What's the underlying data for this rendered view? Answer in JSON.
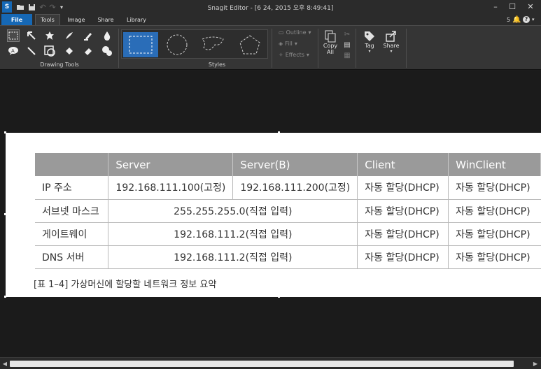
{
  "titlebar": {
    "title": "Snagit Editor - [6 24, 2015 오후 8:49:41]",
    "app_icon": "S",
    "minimize": "–",
    "maximize": "☐",
    "close": "✕"
  },
  "tabs": [
    "File",
    "Tools",
    "Image",
    "Share",
    "Library"
  ],
  "notifications": {
    "count": "5"
  },
  "ribbon": {
    "drawing_tools_label": "Drawing Tools",
    "styles_label": "Styles",
    "outline_label": "Outline",
    "fill_label": "Fill",
    "effects_label": "Effects",
    "copy_label_1": "Copy",
    "copy_label_2": "All",
    "tag_label": "Tag",
    "share_label": "Share"
  },
  "table": {
    "headers": [
      "",
      "Server",
      "Server(B)",
      "Client",
      "WinClient"
    ],
    "rows": [
      [
        "IP 주소",
        "192.168.111.100(고정)",
        "192.168.111.200(고정)",
        "자동 할당(DHCP)",
        "자동 할당(DHCP)"
      ],
      [
        "서브넷 마스크",
        "255.255.255.0(직접 입력)",
        "자동 할당(DHCP)",
        "자동 할당(DHCP)"
      ],
      [
        "게이트웨이",
        "192.168.111.2(직접 입력)",
        "자동 할당(DHCP)",
        "자동 할당(DHCP)"
      ],
      [
        "DNS 서버",
        "192.168.111.2(직접 입력)",
        "자동 할당(DHCP)",
        "자동 할당(DHCP)"
      ]
    ],
    "caption": "[표 1–4] 가상머신에 할당할 네트워크 정보 요약"
  },
  "colors": {
    "file_tab": "#1668b5",
    "selected_style": "#2a6db8",
    "table_header": "#9a9a9a",
    "notification": "#e53935"
  }
}
